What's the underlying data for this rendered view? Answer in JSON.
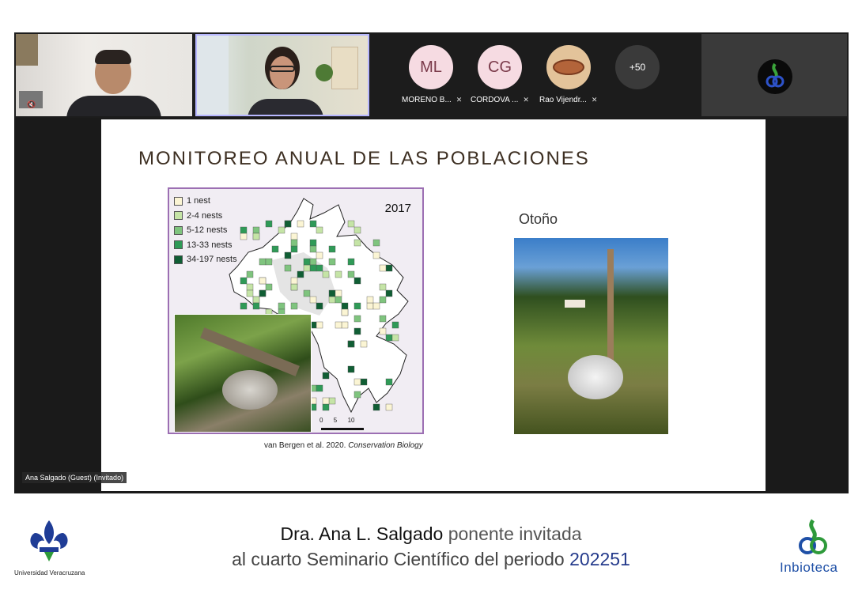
{
  "call": {
    "participants": [
      {
        "initials": "ML",
        "name": "MORENO B...",
        "color": "#f6dbe2"
      },
      {
        "initials": "CG",
        "name": "CORDOVA ...",
        "color": "#f6dbe2"
      },
      {
        "initials": "",
        "name": "Rao Vijendr...",
        "color": "#b3643a"
      }
    ],
    "more_count": "+50",
    "speaker_label": "Ana Salgado (Guest) (Invitado)"
  },
  "slide": {
    "title": "MONITOREO ANUAL DE LAS POBLACIONES",
    "map": {
      "year": "2017",
      "legend": [
        {
          "label": "1 nest",
          "color": "#fbf5d4"
        },
        {
          "label": "2-4 nests",
          "color": "#c5e4a6"
        },
        {
          "label": "5-12 nests",
          "color": "#7fc47e"
        },
        {
          "label": "13-33 nests",
          "color": "#2f9a57"
        },
        {
          "label": "34-197 nests",
          "color": "#105e34"
        }
      ],
      "scale_labels": [
        "0",
        "5",
        "10"
      ]
    },
    "citation_authors": "van Bergen et al. 2020.",
    "citation_journal": "Conservation Biology",
    "season": "Otoño"
  },
  "footer": {
    "speaker_name": "Dra. Ana L. Salgado",
    "speaker_role": "ponente invitada",
    "event_text": "al cuarto Seminario Científico del periodo",
    "period": "202251",
    "left_logo_label": "Universidad Veracruzana",
    "right_logo_label": "Inbioteca"
  }
}
